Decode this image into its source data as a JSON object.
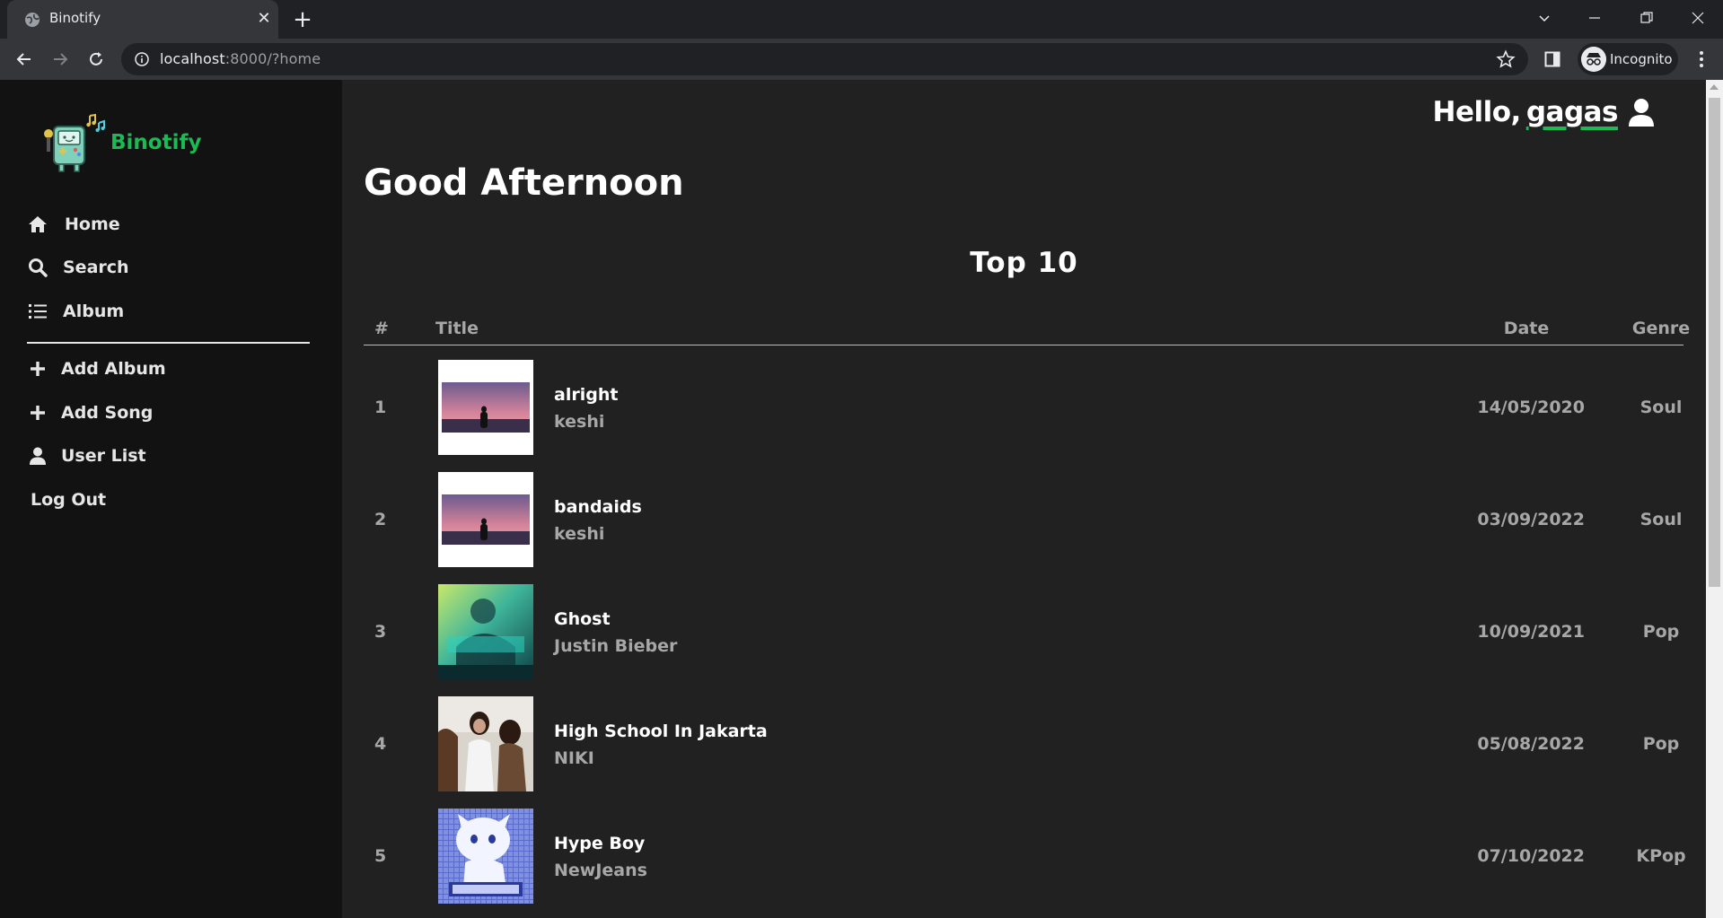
{
  "browser": {
    "tab_title": "Binotify",
    "url_host": "localhost",
    "url_rest": ":8000/?home",
    "profile_label": "Incognito"
  },
  "sidebar": {
    "brand": "Binotify",
    "items": [
      {
        "label": "Home",
        "icon": "home-icon"
      },
      {
        "label": "Search",
        "icon": "search-icon"
      },
      {
        "label": "Album",
        "icon": "list-icon"
      },
      {
        "label": "Add Album",
        "icon": "plus-icon"
      },
      {
        "label": "Add Song",
        "icon": "plus-icon"
      },
      {
        "label": "User List",
        "icon": "user-icon"
      },
      {
        "label": "Log Out",
        "icon": ""
      }
    ]
  },
  "header": {
    "hello": "Hello,",
    "username": "gagas"
  },
  "main": {
    "greeting": "Good Afternoon",
    "section_title": "Top 10",
    "columns": {
      "num": "#",
      "title": "Title",
      "date": "Date",
      "genre": "Genre"
    },
    "songs": [
      {
        "num": "1",
        "title": "alright",
        "artist": "keshi",
        "date": "14/05/2020",
        "genre": "Soul"
      },
      {
        "num": "2",
        "title": "bandaids",
        "artist": "keshi",
        "date": "03/09/2022",
        "genre": "Soul"
      },
      {
        "num": "3",
        "title": "Ghost",
        "artist": "Justin Bieber",
        "date": "10/09/2021",
        "genre": "Pop"
      },
      {
        "num": "4",
        "title": "High School In Jakarta",
        "artist": "NIKI",
        "date": "05/08/2022",
        "genre": "Pop"
      },
      {
        "num": "5",
        "title": "Hype Boy",
        "artist": "NewJeans",
        "date": "07/10/2022",
        "genre": "KPop"
      }
    ]
  },
  "colors": {
    "accent": "#1db954",
    "sidebar_bg": "#121212",
    "main_bg": "#212121",
    "muted_text": "#a7a7a7"
  }
}
